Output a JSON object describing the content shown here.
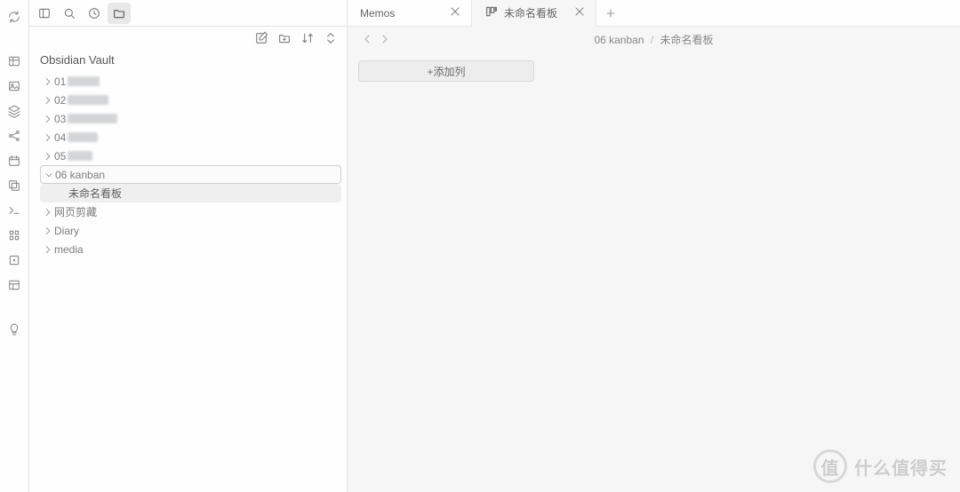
{
  "vault_name": "Obsidian Vault",
  "sidebar_tree": [
    {
      "label": "01",
      "blurW": 36,
      "chev": "right",
      "indent": 0
    },
    {
      "label": "02",
      "blurW": 46,
      "chev": "right",
      "indent": 0
    },
    {
      "label": "03",
      "blurW": 56,
      "chev": "right",
      "indent": 0
    },
    {
      "label": "04",
      "blurW": 34,
      "chev": "right",
      "indent": 0
    },
    {
      "label": "05",
      "blurW": 28,
      "chev": "right",
      "indent": 0
    },
    {
      "label": "06 kanban",
      "chev": "down",
      "indent": 0,
      "selectedBorder": true
    },
    {
      "label": "未命名看板",
      "indent": 1,
      "selectedFill": true
    },
    {
      "label": "网页剪藏",
      "chev": "right",
      "indent": 0
    },
    {
      "label": "Diary",
      "chev": "right",
      "indent": 0
    },
    {
      "label": "media",
      "chev": "right",
      "indent": 0
    }
  ],
  "tabs": [
    {
      "label": "Memos",
      "active": false,
      "icon": false
    },
    {
      "label": "未命名看板",
      "active": true,
      "icon": true
    }
  ],
  "breadcrumb": {
    "folder": "06 kanban",
    "file": "未命名看板",
    "sep": "/"
  },
  "add_column_label": "+添加列",
  "watermark": {
    "circle": "值",
    "text": "什么值得买"
  }
}
